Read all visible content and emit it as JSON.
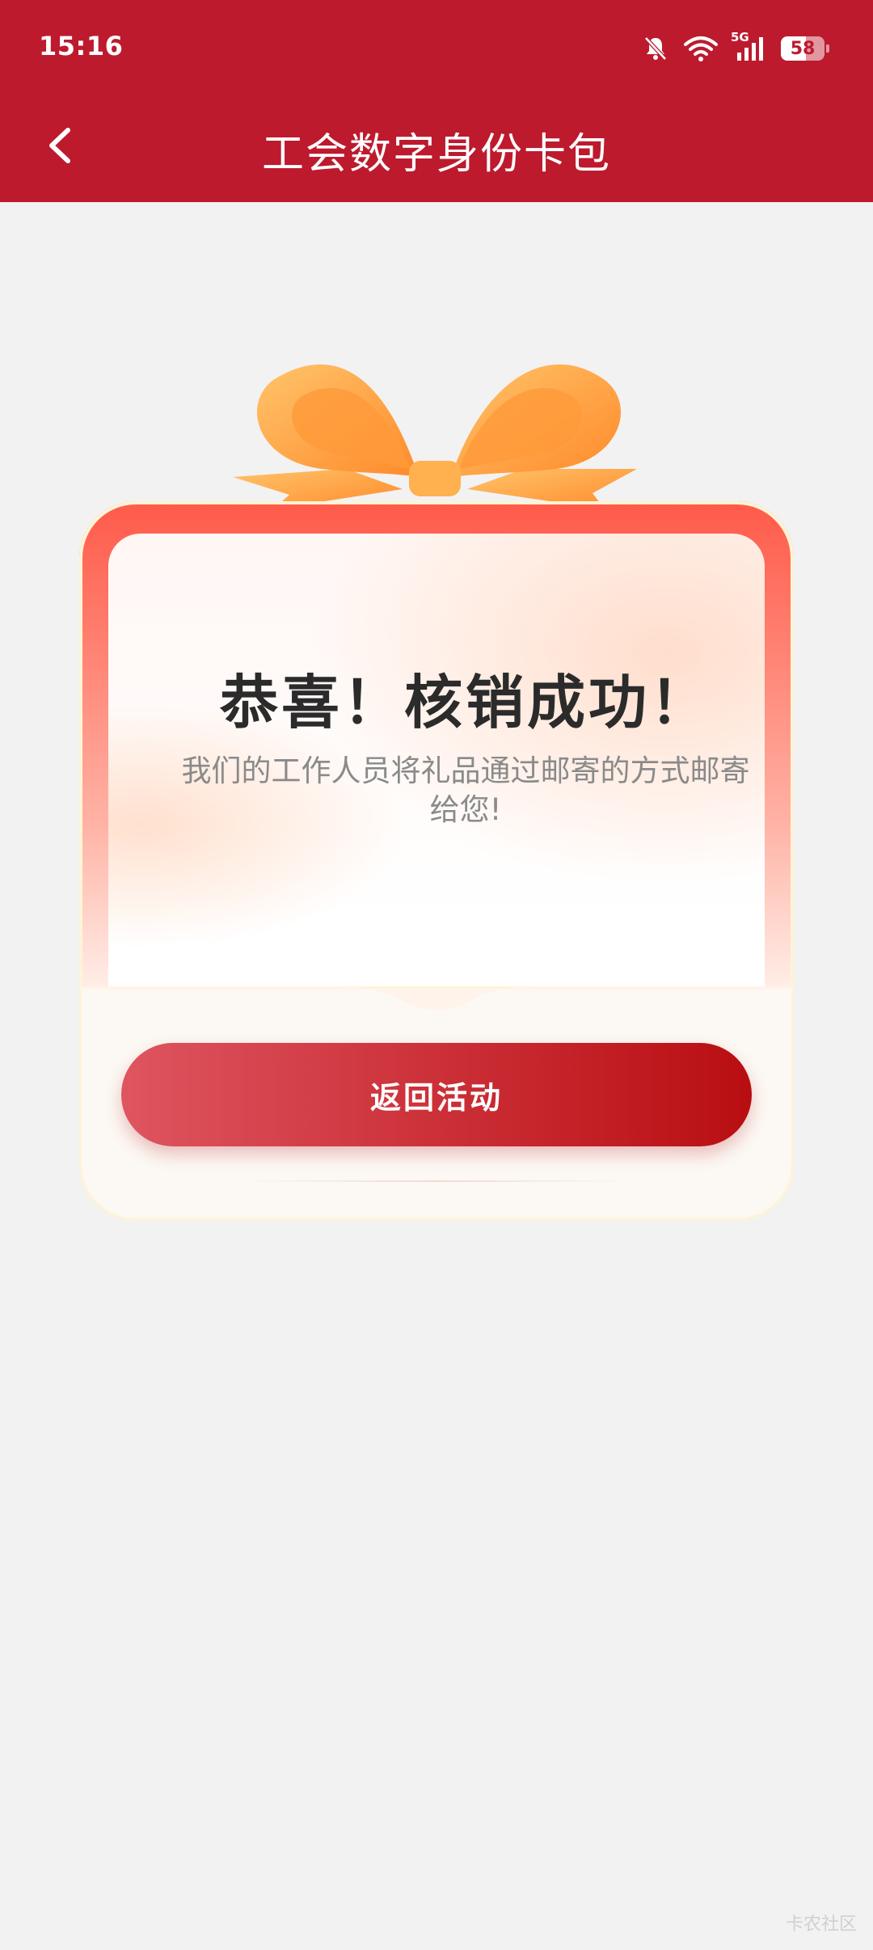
{
  "status_bar": {
    "time": "15:16",
    "network_label": "5G",
    "battery_level": "58",
    "battery_fraction": 0.58
  },
  "nav": {
    "title": "工会数字身份卡包"
  },
  "result": {
    "title": "恭喜！核销成功！",
    "message": "我们的工作人员将礼品通过邮寄的方式邮寄给您!",
    "button_label": "返回活动"
  },
  "watermark": "卡农社区",
  "colors": {
    "header": "#bd1a2e",
    "background": "#f2f2f2",
    "ribbon": "#ffa440",
    "button_start": "#de5560",
    "button_end": "#b80e12"
  },
  "icons": [
    "mute-bell-icon",
    "wifi-icon",
    "signal-icon",
    "battery-icon",
    "back-arrow-icon"
  ]
}
